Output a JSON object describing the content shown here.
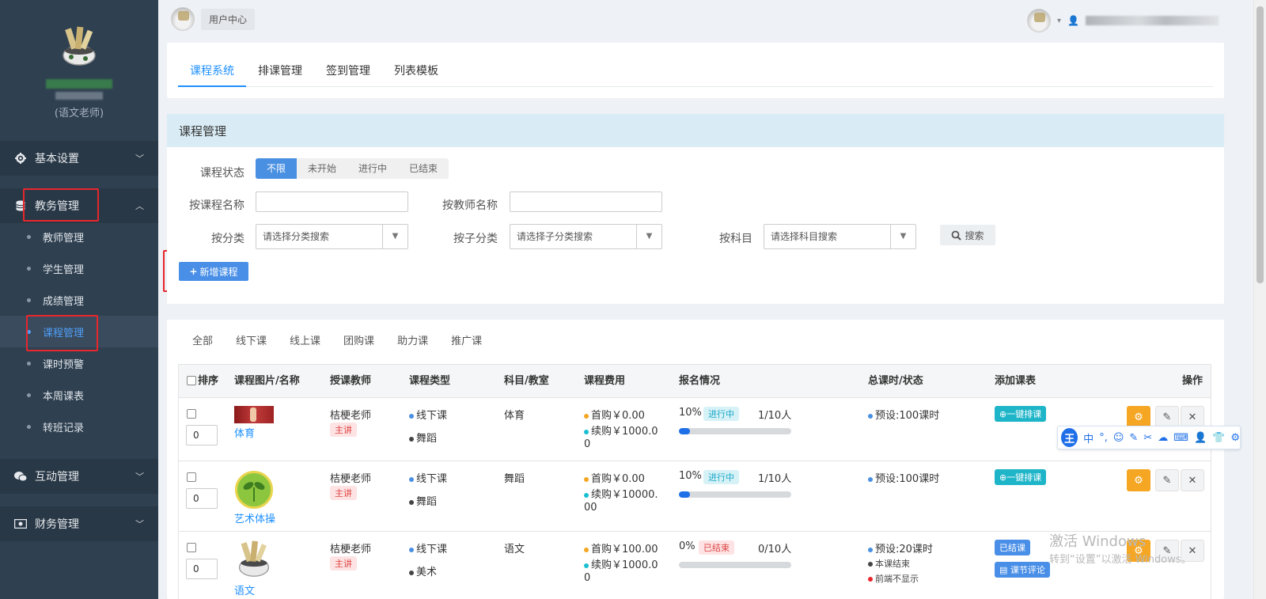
{
  "sidebar": {
    "role": "(语文老师)",
    "groups": [
      {
        "label": "基本设置",
        "icon": "gear-icon"
      },
      {
        "label": "教务管理",
        "icon": "database-icon"
      },
      {
        "label": "互动管理",
        "icon": "wechat-icon"
      },
      {
        "label": "财务管理",
        "icon": "money-icon"
      }
    ],
    "sub_items": [
      "教师管理",
      "学生管理",
      "成绩管理",
      "课程管理",
      "课时预警",
      "本周课表",
      "转班记录"
    ],
    "active_sub": "课程管理"
  },
  "topbar": {
    "user_center": "用户中心"
  },
  "main_tabs": [
    "课程系统",
    "排课管理",
    "签到管理",
    "列表模板"
  ],
  "filter_panel": {
    "title": "课程管理",
    "status_label": "课程状态",
    "status_options": [
      "不限",
      "未开始",
      "进行中",
      "已结束"
    ],
    "course_name_label": "按课程名称",
    "teacher_name_label": "按教师名称",
    "category_label": "按分类",
    "category_placeholder": "请选择分类搜索",
    "subcategory_label": "按子分类",
    "subcategory_placeholder": "请选择子分类搜索",
    "subject_label": "按科目",
    "subject_placeholder": "请选择科目搜索",
    "search_button": "搜索",
    "add_button": "新增课程"
  },
  "list_panel": {
    "type_tabs": [
      "全部",
      "线下课",
      "线上课",
      "团购课",
      "助力课",
      "推广课"
    ],
    "headers": {
      "sort": "排序",
      "image_name": "课程图片/名称",
      "teacher": "授课教师",
      "type": "课程类型",
      "subject": "科目/教室",
      "fee": "课程费用",
      "enroll": "报名情况",
      "total": "总课时/状态",
      "schedule": "添加课表",
      "ops": "操作"
    },
    "rows": [
      {
        "sort": "0",
        "name": "体育",
        "teacher": "桔梗老师",
        "teacher_tag": "主讲",
        "type1": "线下课",
        "type2": "舞蹈",
        "subject": "体育",
        "fee1": "首购￥0.00",
        "fee2a": "续购￥1000.0",
        "fee2b": "0",
        "pct": "10%",
        "status_tag": "进行中",
        "count": "1/10人",
        "progress": 0.1,
        "total": "预设:100课时",
        "schedule_btn": "一键排课"
      },
      {
        "sort": "0",
        "name": "艺术体操",
        "teacher": "桔梗老师",
        "teacher_tag": "主讲",
        "type1": "线下课",
        "type2": "舞蹈",
        "subject": "舞蹈",
        "fee1": "首购￥0.00",
        "fee2a": "续购￥10000.",
        "fee2b": "00",
        "pct": "10%",
        "status_tag": "进行中",
        "count": "1/10人",
        "progress": 0.1,
        "total": "预设:100课时",
        "schedule_btn": "一键排课"
      },
      {
        "sort": "0",
        "name": "语文",
        "teacher": "桔梗老师",
        "teacher_tag": "主讲",
        "type1": "线下课",
        "type2": "美术",
        "subject": "语文",
        "fee1": "首购￥100.00",
        "fee2a": "续购￥1000.0",
        "fee2b": "0",
        "pct": "0%",
        "status_tag": "已结束",
        "count": "0/10人",
        "progress": 0,
        "total": "预设:20课时",
        "extra1": "本课结束",
        "extra2": "前端不显示",
        "done_btn": "已结课",
        "comment_btn": "课节评论"
      }
    ]
  },
  "ime": {
    "logo": "王",
    "lang": "中"
  },
  "watermark": {
    "line1": "激活 Windows",
    "line2": "转到“设置”以激活 Windows。"
  }
}
